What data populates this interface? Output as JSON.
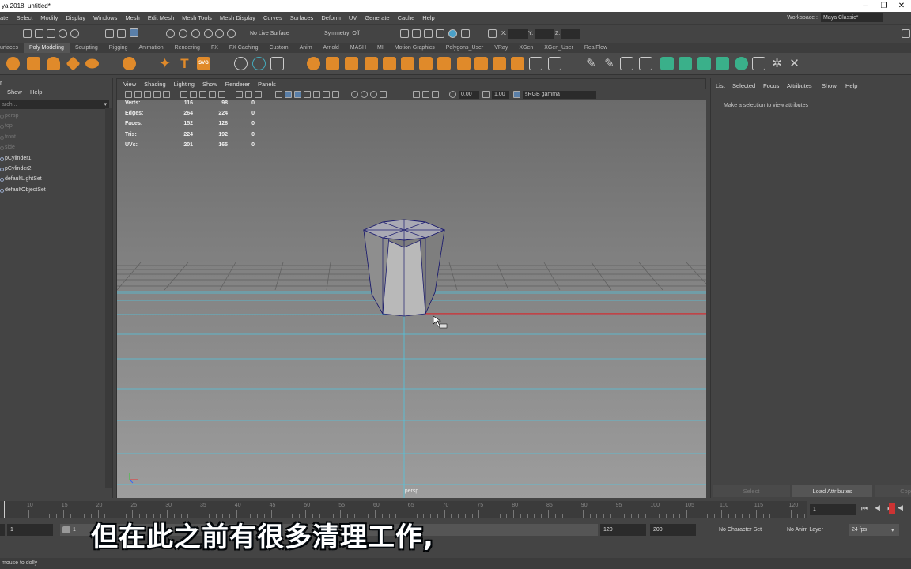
{
  "window": {
    "title": "ya 2018: untitled*",
    "minimize": "–",
    "maximize": "❐",
    "close": "✕"
  },
  "menu": [
    "ate",
    "Select",
    "Modify",
    "Display",
    "Windows",
    "Mesh",
    "Edit Mesh",
    "Mesh Tools",
    "Mesh Display",
    "Curves",
    "Surfaces",
    "Deform",
    "UV",
    "Generate",
    "Cache",
    "Help"
  ],
  "workspace": {
    "label": "Workspace :",
    "value": "Maya Classic*"
  },
  "status_line": {
    "live_surface": "No Live Surface",
    "symmetry": "Symmetry: Off",
    "x_label": "X:",
    "y_label": "Y:",
    "z_label": "Z:"
  },
  "shelf_tabs": [
    "urfaces",
    "Poly Modeling",
    "Sculpting",
    "Rigging",
    "Animation",
    "Rendering",
    "FX",
    "FX Caching",
    "Custom",
    "Anim",
    "Arnold",
    "MASH",
    "MI",
    "Motion Graphics",
    "Polygons_User",
    "VRay",
    "XGen",
    "XGen_User",
    "RealFlow"
  ],
  "shelf_active": "Poly Modeling",
  "shelf_svg_label": "SVG",
  "outliner": {
    "menu": [
      "r",
      "Show",
      "Help"
    ],
    "search_placeholder": "arch...",
    "items": [
      {
        "label": "persp",
        "dim": true
      },
      {
        "label": "top",
        "dim": true
      },
      {
        "label": "front",
        "dim": true
      },
      {
        "label": "side",
        "dim": true
      },
      {
        "label": "pCylinder1",
        "dim": false
      },
      {
        "label": "pCylinder2",
        "dim": false
      },
      {
        "label": "defaultLightSet",
        "dim": false
      },
      {
        "label": "defaultObjectSet",
        "dim": false
      }
    ]
  },
  "viewport": {
    "menu": [
      "View",
      "Shading",
      "Lighting",
      "Show",
      "Renderer",
      "Panels"
    ],
    "exposure": "0.00",
    "gamma": "1.00",
    "color_space": "sRGB gamma",
    "camera": "persp",
    "hud": [
      {
        "label": "Verts:",
        "v1": "116",
        "v2": "98",
        "v3": "0"
      },
      {
        "label": "Edges:",
        "v1": "264",
        "v2": "224",
        "v3": "0"
      },
      {
        "label": "Faces:",
        "v1": "152",
        "v2": "128",
        "v3": "0"
      },
      {
        "label": "Tris:",
        "v1": "224",
        "v2": "192",
        "v3": "0"
      },
      {
        "label": "UVs:",
        "v1": "201",
        "v2": "165",
        "v3": "0"
      }
    ]
  },
  "attribute_editor": {
    "menu": [
      "List",
      "Selected",
      "Focus",
      "Attributes",
      "Show",
      "Help"
    ],
    "message": "Make a selection to view attributes",
    "select_button": "Select",
    "load_button": "Load Attributes",
    "copy_button": "Cop"
  },
  "timeline": {
    "ticks": [
      "10",
      "15",
      "20",
      "25",
      "30",
      "35",
      "40",
      "45",
      "50",
      "55",
      "60",
      "65",
      "70",
      "75",
      "80",
      "85",
      "90",
      "95",
      "100",
      "105",
      "110",
      "115",
      "120"
    ],
    "current_frame": "1"
  },
  "range": {
    "start": "1",
    "playback_start": "1",
    "playback_end": "120",
    "end": "200",
    "character_set": "No Character Set",
    "anim_layer": "No Anim Layer",
    "fps": "24 fps"
  },
  "help_line": "mouse to dolly",
  "subtitle": "但在此之前有很多清理工作,"
}
